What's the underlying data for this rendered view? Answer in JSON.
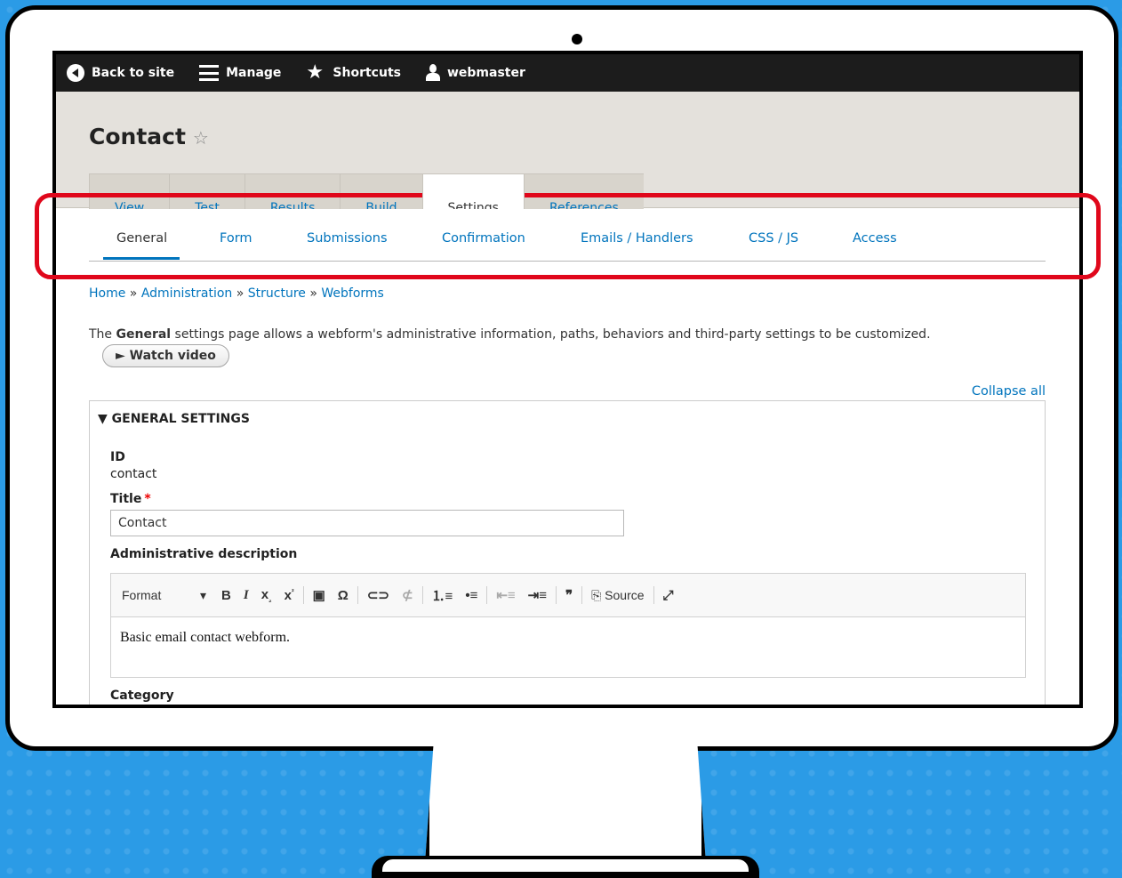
{
  "toolbar": {
    "back_label": "Back to site",
    "manage_label": "Manage",
    "shortcuts_label": "Shortcuts",
    "user_label": "webmaster"
  },
  "page": {
    "title": "Contact"
  },
  "tabs": [
    {
      "label": "View"
    },
    {
      "label": "Test"
    },
    {
      "label": "Results"
    },
    {
      "label": "Build"
    },
    {
      "label": "Settings"
    },
    {
      "label": "References"
    }
  ],
  "subtabs": [
    {
      "label": "General"
    },
    {
      "label": "Form"
    },
    {
      "label": "Submissions"
    },
    {
      "label": "Confirmation"
    },
    {
      "label": "Emails / Handlers"
    },
    {
      "label": "CSS / JS"
    },
    {
      "label": "Access"
    }
  ],
  "breadcrumb": {
    "items": [
      "Home",
      "Administration",
      "Structure",
      "Webforms"
    ],
    "sep": "»"
  },
  "intro": {
    "prefix": "The ",
    "bold": "General",
    "suffix": " settings page allows a webform's administrative information, paths, behaviors and third-party settings to be customized."
  },
  "watch_video": "► Watch video",
  "collapse_all": "Collapse all",
  "general": {
    "legend": "▼ GENERAL SETTINGS",
    "id_label": "ID",
    "id_value": "contact",
    "title_label": "Title",
    "required_mark": "*",
    "title_value": "Contact",
    "desc_label": "Administrative description",
    "category_label": "Category"
  },
  "editor": {
    "format_label": "Format",
    "format_caret": "▾",
    "source_label": "Source",
    "body": "Basic email contact webform."
  },
  "colors": {
    "toolbar_bg": "#1c1c1c",
    "link": "#0074bd",
    "highlight": "#e0071b",
    "header_bg": "#e4e1dc"
  }
}
